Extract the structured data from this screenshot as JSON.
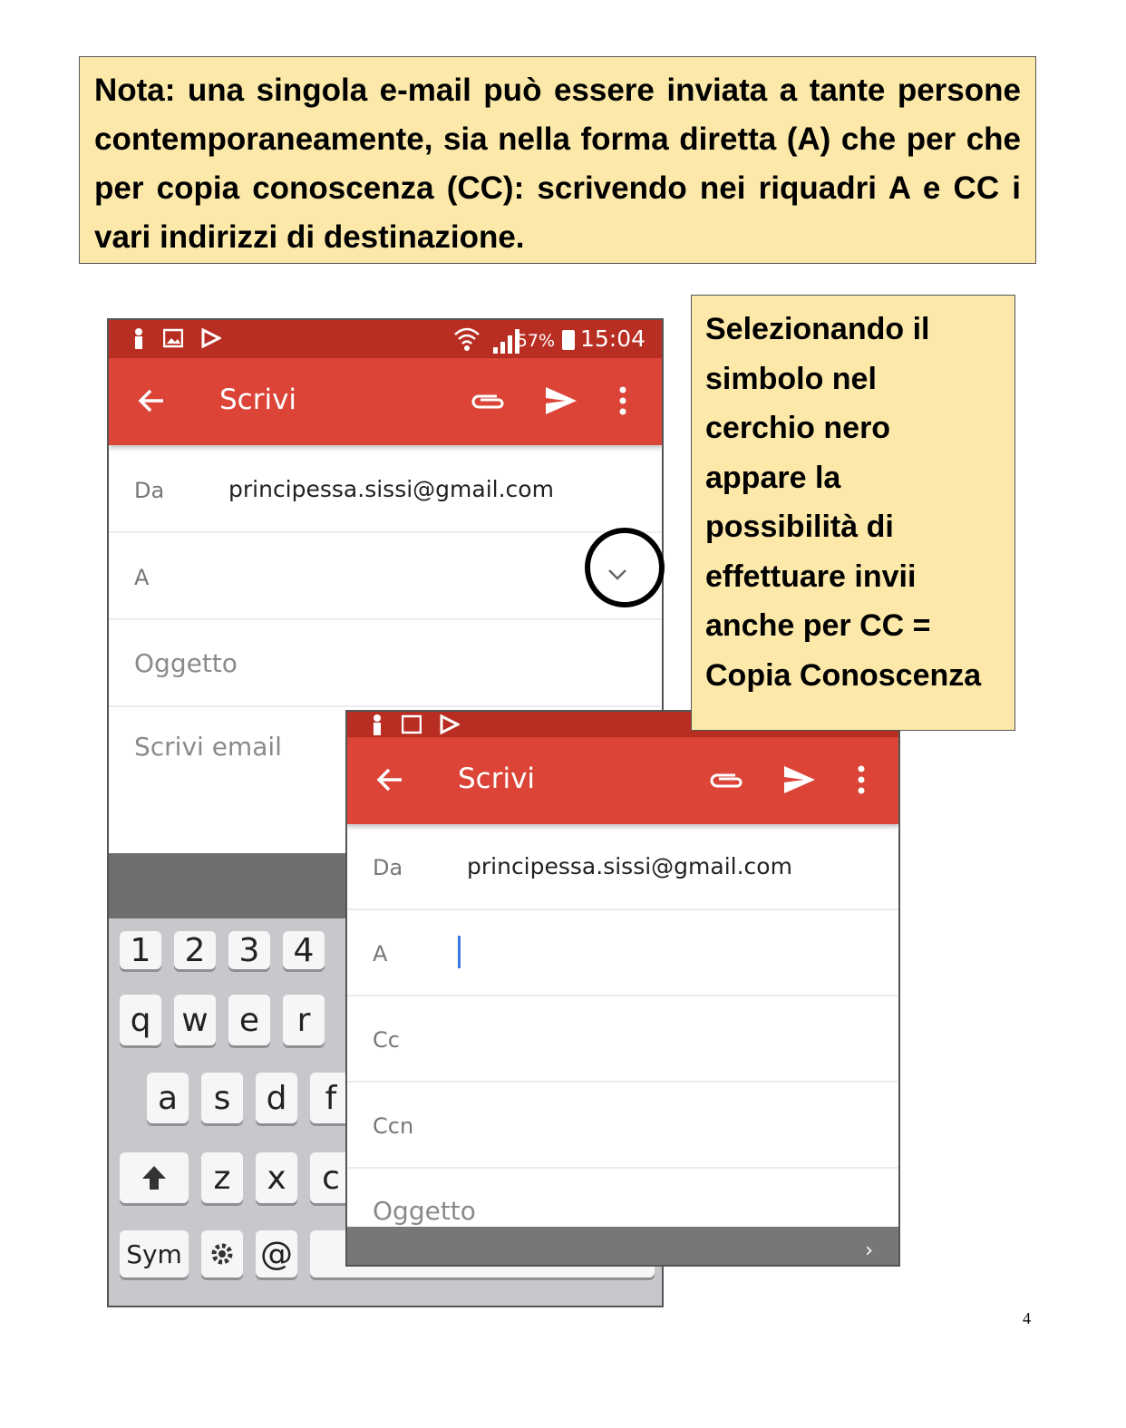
{
  "note": {
    "text": "Nota: una singola e-mail può essere inviata a tante persone contemporaneamente, sia nella forma diretta (A) che per che per copia conoscenza (CC): scrivendo nei riquadri A e CC i vari indirizzi di destinazione."
  },
  "callout": {
    "lines": [
      "Selezionando il",
      "simbolo nel",
      "cerchio nero",
      "appare la",
      "possibilità di",
      "effettuare invii",
      "anche per CC =",
      "Copia Conoscenza"
    ]
  },
  "page_number": "4",
  "phone1": {
    "status": {
      "battery_pct": "57%",
      "time": "15:04"
    },
    "toolbar": {
      "title": "Scrivi"
    },
    "from_label": "Da",
    "from_value": "principessa.sissi@gmail.com",
    "to_label": "A",
    "subject_placeholder": "Oggetto",
    "body_placeholder": "Scrivi email",
    "keyboard": {
      "numbers": [
        "1",
        "2",
        "3",
        "4"
      ],
      "row1": [
        "q",
        "w",
        "e",
        "r"
      ],
      "row2": [
        "a",
        "s",
        "d",
        "f"
      ],
      "row3": [
        "z",
        "x",
        "c"
      ],
      "sym": "Sym",
      "at": "@"
    }
  },
  "phone2": {
    "toolbar": {
      "title": "Scrivi"
    },
    "from_label": "Da",
    "from_value": "principessa.sissi@gmail.com",
    "to_label": "A",
    "cc_label": "Cc",
    "bcc_label": "Ccn",
    "subject_placeholder": "Oggetto"
  },
  "colors": {
    "status_bar": "#b92e23",
    "toolbar": "#db4437",
    "note_bg": "#fce8a8"
  }
}
